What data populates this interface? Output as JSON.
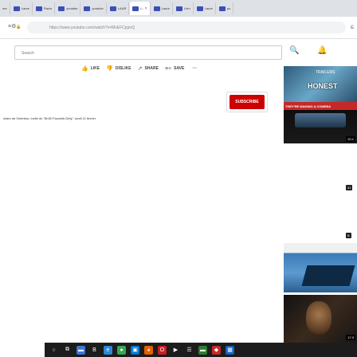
{
  "tabs": [
    {
      "label": "Laure",
      "icon": "site-favicon",
      "active": false
    },
    {
      "label": "Racio",
      "icon": "site-favicon",
      "active": false
    },
    {
      "label": "youtube",
      "icon": "site-favicon",
      "active": false
    },
    {
      "label": "youtube",
      "icon": "site-favicon",
      "active": false
    },
    {
      "label": "LAUR",
      "icon": "site-favicon",
      "active": false
    },
    {
      "label": "L:",
      "icon": "site-favicon",
      "active": true
    },
    {
      "label": "Laure",
      "icon": "site-favicon",
      "active": false
    },
    {
      "label": "Lhm",
      "icon": "site-favicon",
      "active": false
    },
    {
      "label": "Laure",
      "icon": "site-favicon",
      "active": false
    },
    {
      "label": "pu",
      "icon": "site-favicon",
      "active": false
    }
  ],
  "tab_prefix": "ure",
  "tab_close": "×",
  "omnibar": {
    "url": "https://www.youtube.com/watch?v=MxEFCjqnrQ",
    "left_icons": "≡⚙",
    "lock": "🔒",
    "right_icon": "ɕ"
  },
  "youtube": {
    "search_placeholder": "Search",
    "search_icon": "🔍",
    "bell_icon": "🔔",
    "actions": {
      "like": "LIKE",
      "dislike": "DISLIKE",
      "share": "SHARE",
      "save": "SAVE",
      "more": "···"
    },
    "action_icons": {
      "like": "👍",
      "dislike": "👎",
      "share": "↗",
      "save": "≡+"
    },
    "subscribe": "SUBSCRIBE",
    "description": "nistre de l'intérieur, invité du \"8h30 Fauvelle-Dély\", lundi 11 février"
  },
  "thumbnails": {
    "t1_text": "HONEST",
    "t1_small": "TRAILERS",
    "t2_banner": "THEY'RE MAKING A COMEBA",
    "t2_duration": "20:1",
    "badge1": "41",
    "badge2": "B",
    "t4_duration": "17:3"
  },
  "taskbar": [
    {
      "name": "search-icon",
      "glyph": "○",
      "color": "#1c1c1c"
    },
    {
      "name": "taskview-icon",
      "glyph": "⧉",
      "color": "#1c1c1c"
    },
    {
      "name": "app-icon-1",
      "glyph": "▬",
      "color": "#3b78d8"
    },
    {
      "name": "app-icon-2",
      "glyph": "B",
      "color": "#1c1c1c"
    },
    {
      "name": "app-icon-edge",
      "glyph": "e",
      "color": "#2b89d6"
    },
    {
      "name": "app-icon-chrome",
      "glyph": "●",
      "color": "#34a853"
    },
    {
      "name": "app-icon-store",
      "glyph": "▣",
      "color": "#0078d4"
    },
    {
      "name": "app-icon-firefox",
      "glyph": "◕",
      "color": "#e66000"
    },
    {
      "name": "app-icon-opera",
      "glyph": "O",
      "color": "#cc1b24"
    },
    {
      "name": "app-icon-3",
      "glyph": "▶",
      "color": "#1c1c1c"
    },
    {
      "name": "app-icon-4",
      "glyph": "☰",
      "color": "#1c1c1c"
    },
    {
      "name": "app-icon-5",
      "glyph": "▬",
      "color": "#2e7d32"
    },
    {
      "name": "app-icon-6",
      "glyph": "◆",
      "color": "#c62828"
    },
    {
      "name": "app-icon-7",
      "glyph": "▦",
      "color": "#1565c0"
    }
  ]
}
